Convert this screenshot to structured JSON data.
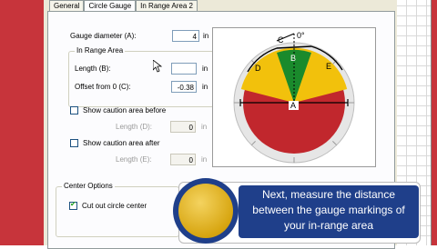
{
  "tabs": [
    {
      "label": "General"
    },
    {
      "label": "Circle Gauge"
    },
    {
      "label": "In Range Area 2"
    }
  ],
  "form": {
    "gauge_diameter_label": "Gauge diameter (A):",
    "gauge_diameter_value": "4",
    "gauge_diameter_unit": "in",
    "in_range_group_title": "In Range Area",
    "length_b_label": "Length (B):",
    "length_b_value": "",
    "length_b_unit": "in",
    "offset_label": "Offset from 0 (C):",
    "offset_value": "-0.38",
    "offset_unit": "in",
    "show_caution_before_label": "Show caution area before",
    "length_d_label": "Length (D):",
    "length_d_value": "0",
    "length_d_unit": "in",
    "show_caution_after_label": "Show caution area after",
    "length_e_label": "Length (E):",
    "length_e_value": "0",
    "length_e_unit": "in",
    "center_group_title": "Center Options",
    "cut_out_label": "Cut out circle center",
    "cut_out_checked": true
  },
  "gauge": {
    "zero_label": "0°",
    "labels": {
      "a": "A",
      "b": "B",
      "c": "C",
      "d": "D",
      "e": "E"
    },
    "colors": {
      "red": "#c1272d",
      "yellow": "#f2c10c",
      "green": "#1a8a2c"
    }
  },
  "callout": {
    "text": "Next, measure the distance between the gauge markings of your in-range area"
  },
  "colors": {
    "accent_red": "#c7343b",
    "callout_blue": "#1f3f8a"
  }
}
